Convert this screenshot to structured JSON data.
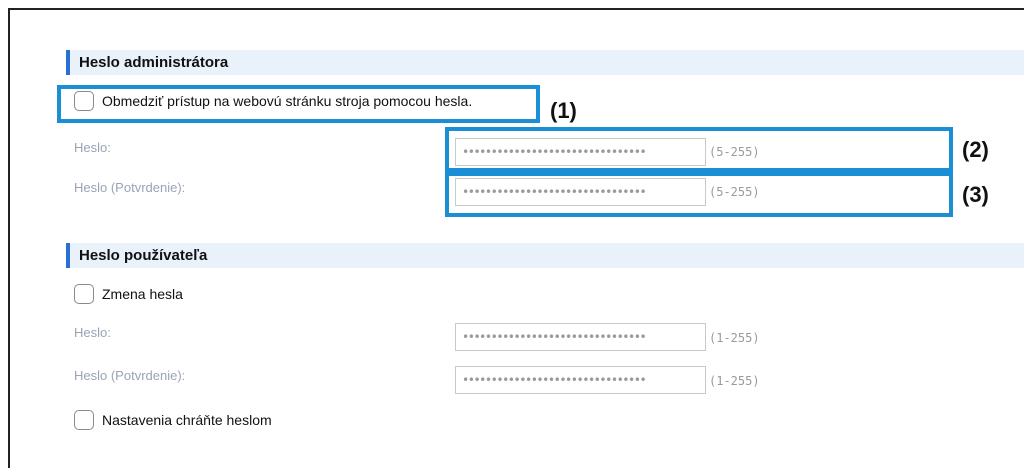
{
  "admin": {
    "header": "Heslo administrátora",
    "restrict_label": "Obmedziť prístup na webovú stránku stroja pomocou hesla.",
    "password_label": "Heslo:",
    "confirm_label": "Heslo (Potvrdenie):",
    "password_value": "••••••••••••••••••••••••••••••••",
    "confirm_value": "••••••••••••••••••••••••••••••••",
    "range": "(5-255)"
  },
  "user": {
    "header": "Heslo používateľa",
    "change_label": "Zmena hesla",
    "password_label": "Heslo:",
    "confirm_label": "Heslo (Potvrdenie):",
    "password_value": "••••••••••••••••••••••••••••••••",
    "confirm_value": "••••••••••••••••••••••••••••••••",
    "range": "(1-255)",
    "protect_label": "Nastavenia chráňte heslom"
  },
  "callouts": [
    "(1)",
    "(2)",
    "(3)"
  ],
  "colors": {
    "callout_border": "#1a8fd6",
    "header_bg": "#e9f1fb",
    "header_bar": "#2a6fd6",
    "label": "#98a4b6"
  }
}
